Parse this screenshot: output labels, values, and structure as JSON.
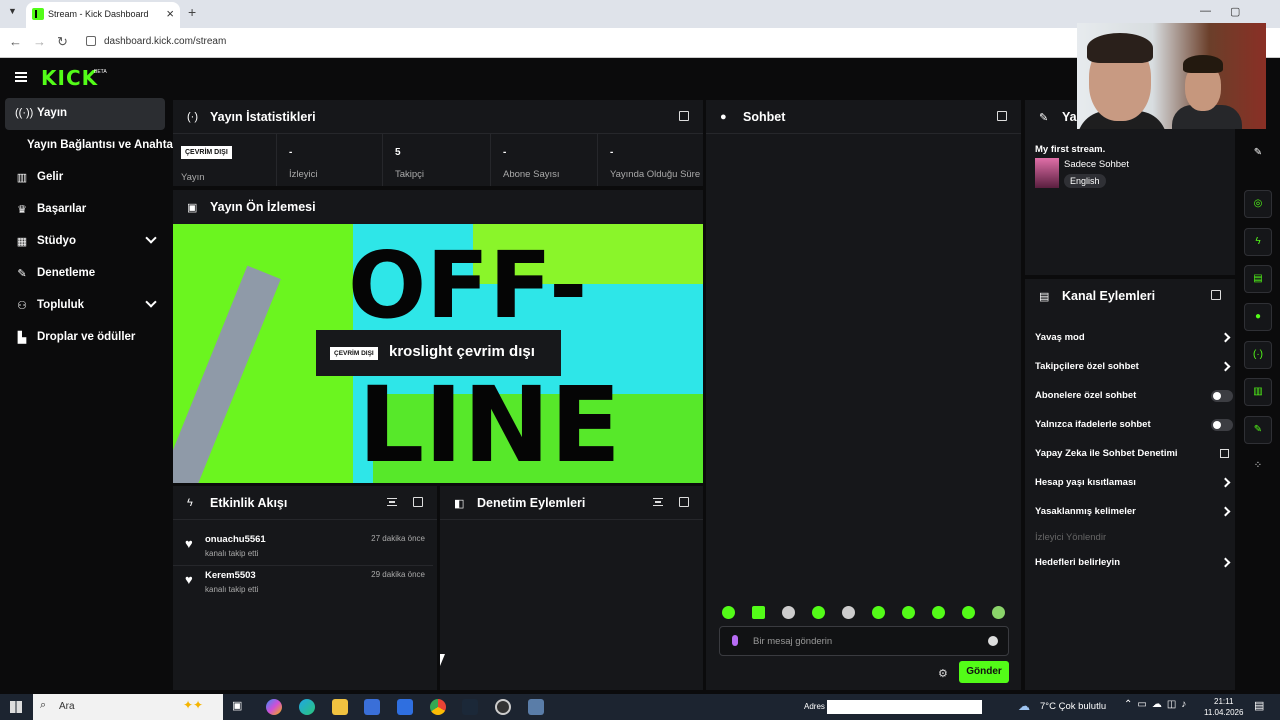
{
  "browser": {
    "tab_title": "Stream - Kick Dashboard",
    "url": "dashboard.kick.com/stream"
  },
  "brand": {
    "logo": "KICK",
    "beta": "BETA",
    "accent": "#53fc18"
  },
  "sidebar": {
    "items": [
      {
        "label": "Yayın",
        "icon": "broadcast-icon"
      },
      {
        "label": "Yayın Bağlantısı ve Anahtarı",
        "icon": ""
      },
      {
        "label": "Gelir",
        "icon": "chart-icon"
      },
      {
        "label": "Başarılar",
        "icon": "trophy-icon"
      },
      {
        "label": "Stüdyo",
        "icon": "studio-icon"
      },
      {
        "label": "Denetleme",
        "icon": "wrench-icon"
      },
      {
        "label": "Topluluk",
        "icon": "community-icon"
      },
      {
        "label": "Droplar ve ödüller",
        "icon": "drops-icon"
      }
    ]
  },
  "stats": {
    "title": "Yayın İstatistikleri",
    "offline_badge": "ÇEVRİM DIŞI",
    "items": [
      {
        "value": "",
        "label": "Yayın"
      },
      {
        "value": "-",
        "label": "İzleyici"
      },
      {
        "value": "5",
        "label": "Takipçi"
      },
      {
        "value": "-",
        "label": "Abone Sayısı"
      },
      {
        "value": "-",
        "label": "Yayında Olduğu Süre"
      }
    ]
  },
  "preview": {
    "title": "Yayın Ön İzlemesi",
    "big_text_1": "OFF-",
    "big_text_2": "LINE",
    "badge": "ÇEVRİM DIŞI",
    "status_text": "kroslight çevrim dışı"
  },
  "activity": {
    "title": "Etkinlik Akışı",
    "events": [
      {
        "user": "onuachu5561",
        "action": "kanalı takip etti",
        "time": "27 dakika önce"
      },
      {
        "user": "Kerem5503",
        "action": "kanalı takip etti",
        "time": "29 dakika önce"
      }
    ]
  },
  "moderation": {
    "title": "Denetim Eylemleri"
  },
  "chat": {
    "title": "Sohbet",
    "placeholder": "Bir mesaj gönderin",
    "send_label": "Gönder"
  },
  "stream_info": {
    "title": "Ya",
    "stream_title": "My first stream.",
    "category": "Sadece Sohbet",
    "language": "English"
  },
  "channel_actions": {
    "title": "Kanal Eylemleri",
    "items": [
      {
        "label": "Yavaş mod",
        "control": "chevron"
      },
      {
        "label": "Takipçilere özel sohbet",
        "control": "chevron"
      },
      {
        "label": "Abonelere özel sohbet",
        "control": "toggle"
      },
      {
        "label": "Yalnızca ifadelerle sohbet",
        "control": "toggle"
      },
      {
        "label": "Yapay Zeka ile Sohbet Denetimi",
        "control": "external"
      },
      {
        "label": "Hesap yaşı kısıtlaması",
        "control": "chevron"
      },
      {
        "label": "Yasaklanmış kelimeler",
        "control": "chevron"
      },
      {
        "label": "İzleyici Yönlendir",
        "control": "disabled"
      },
      {
        "label": "Hedefleri belirleyin",
        "control": "chevron"
      }
    ]
  },
  "taskbar": {
    "search_label": "Ara",
    "address_label": "Adres",
    "weather": "7°C  Çok bulutlu",
    "time": "21:11",
    "date": "11.04.2026"
  }
}
